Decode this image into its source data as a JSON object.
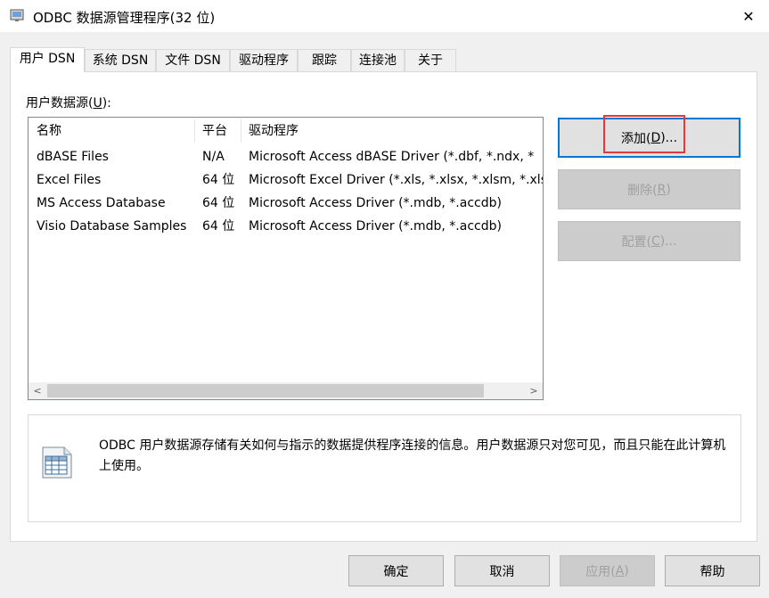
{
  "window": {
    "title": "ODBC 数据源管理程序(32 位)",
    "close_glyph": "✕"
  },
  "tabs": [
    {
      "label": "用户 DSN",
      "active": true
    },
    {
      "label": "系统 DSN"
    },
    {
      "label": "文件 DSN"
    },
    {
      "label": "驱动程序"
    },
    {
      "label": "跟踪"
    },
    {
      "label": "连接池"
    },
    {
      "label": "关于"
    }
  ],
  "section": {
    "label_prefix": "用户数据源(",
    "label_key": "U",
    "label_suffix": "):"
  },
  "list": {
    "columns": [
      "名称",
      "平台",
      "驱动程序"
    ],
    "rows": [
      {
        "name": "dBASE Files",
        "platform": "N/A",
        "driver": "Microsoft Access dBASE Driver (*.dbf, *.ndx, *"
      },
      {
        "name": "Excel Files",
        "platform": "64 位",
        "driver": "Microsoft Excel Driver (*.xls, *.xlsx, *.xlsm, *.xls"
      },
      {
        "name": "MS Access Database",
        "platform": "64 位",
        "driver": "Microsoft Access Driver (*.mdb, *.accdb)"
      },
      {
        "name": "Visio Database Samples",
        "platform": "64 位",
        "driver": "Microsoft Access Driver (*.mdb, *.accdb)"
      }
    ],
    "scroll_left": "<",
    "scroll_right": ">"
  },
  "side_buttons": {
    "add": {
      "prefix": "添加(",
      "key": "D",
      "suffix": ")..."
    },
    "remove": {
      "prefix": "删除(",
      "key": "R",
      "suffix": ")"
    },
    "configure": {
      "prefix": "配置(",
      "key": "C",
      "suffix": ")..."
    }
  },
  "info": {
    "text": "ODBC 用户数据源存储有关如何与指示的数据提供程序连接的信息。用户数据源只对您可见，而且只能在此计算机上使用。"
  },
  "bottom_buttons": {
    "ok": "确定",
    "cancel": "取消",
    "apply": {
      "prefix": "应用(",
      "key": "A",
      "suffix": ")"
    },
    "help": "帮助"
  },
  "colors": {
    "accent": "#0078d7",
    "highlight_border": "#e0393e",
    "disabled_text": "#a0a0a0"
  }
}
